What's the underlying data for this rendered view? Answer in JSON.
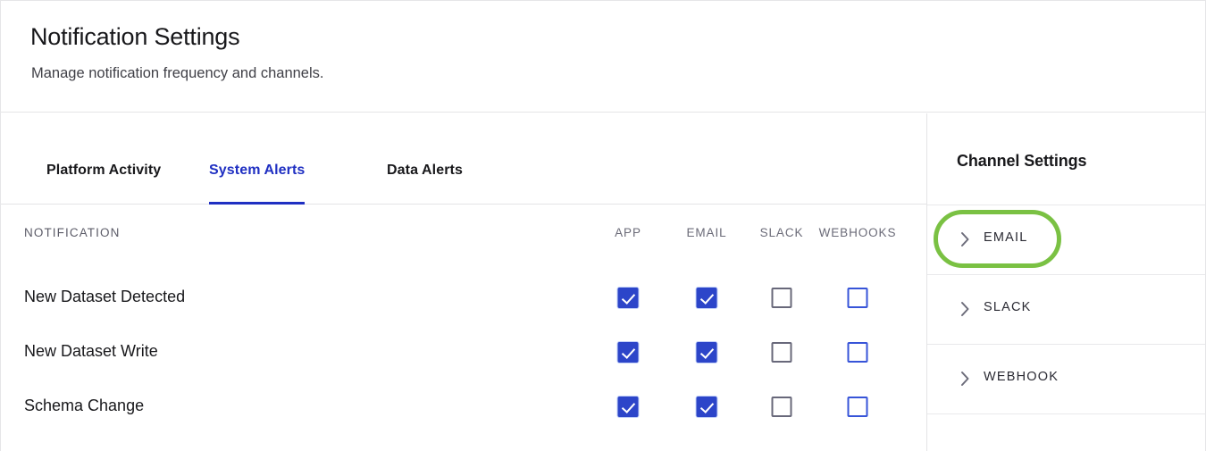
{
  "header": {
    "title": "Notification Settings",
    "subtitle": "Manage notification frequency and channels."
  },
  "tabs": [
    {
      "label": "Platform Activity",
      "active": false
    },
    {
      "label": "System Alerts",
      "active": true
    },
    {
      "label": "Data Alerts",
      "active": false
    }
  ],
  "table": {
    "notification_column_header": "NOTIFICATION",
    "channel_columns": [
      "APP",
      "EMAIL",
      "SLACK",
      "WEBHOOKS"
    ],
    "rows": [
      {
        "label": "New Dataset Detected",
        "app": "checked",
        "email": "checked",
        "slack": "unchecked-gray",
        "webhooks": "unchecked-blue"
      },
      {
        "label": "New Dataset Write",
        "app": "checked",
        "email": "checked",
        "slack": "unchecked-gray",
        "webhooks": "unchecked-blue"
      },
      {
        "label": "Schema Change",
        "app": "checked",
        "email": "checked",
        "slack": "unchecked-gray",
        "webhooks": "unchecked-blue"
      }
    ]
  },
  "channel_settings": {
    "title": "Channel Settings",
    "items": [
      {
        "label": "EMAIL",
        "icon": "chevron-right-icon",
        "highlighted": true
      },
      {
        "label": "SLACK",
        "icon": "chevron-right-icon",
        "highlighted": false
      },
      {
        "label": "WEBHOOK",
        "icon": "chevron-right-icon",
        "highlighted": false
      }
    ]
  },
  "colors": {
    "accent_blue": "#1f2fc2",
    "checkbox_blue": "#2c45c9",
    "checkbox_border_blue": "#3754d8",
    "checkbox_border_gray": "#68687a",
    "annotation_green": "#7ac143",
    "text_primary": "#18181b",
    "text_muted": "#5c5c68",
    "divider": "#e4e4e6"
  }
}
